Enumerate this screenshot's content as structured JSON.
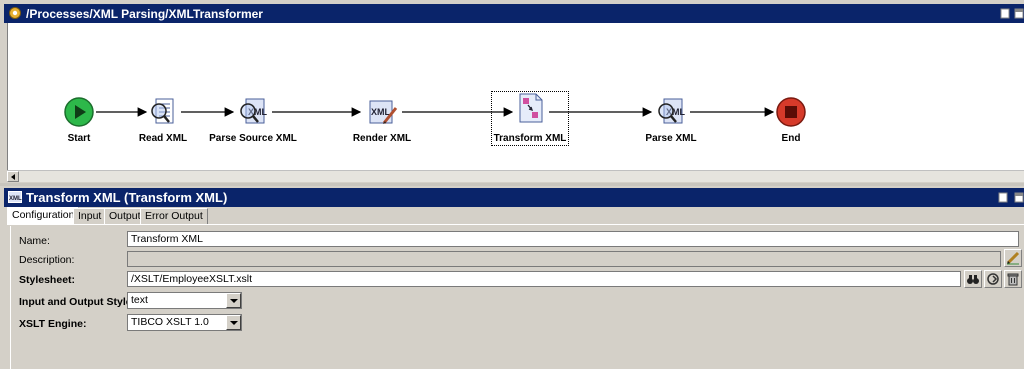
{
  "process": {
    "title": "/Processes/XML Parsing/XMLTransformer",
    "nodes": [
      {
        "label": "Start",
        "icon": "start-icon"
      },
      {
        "label": "Read XML",
        "icon": "read-xml-icon"
      },
      {
        "label": "Parse Source XML",
        "icon": "parse-xml-icon"
      },
      {
        "label": "Render XML",
        "icon": "render-xml-icon"
      },
      {
        "label": "Transform XML",
        "icon": "transform-xml-icon"
      },
      {
        "label": "Parse XML",
        "icon": "parse-xml-icon"
      },
      {
        "label": "End",
        "icon": "end-icon"
      }
    ]
  },
  "props": {
    "title": "Transform XML (Transform XML)",
    "tabs": [
      "Configuration",
      "Input",
      "Output",
      "Error Output"
    ],
    "active_tab": "Configuration",
    "fields": {
      "name_label": "Name:",
      "name_value": "Transform XML",
      "description_label": "Description:",
      "description_value": "",
      "stylesheet_label": "Stylesheet:",
      "stylesheet_value": "/XSLT/EmployeeXSLT.xslt",
      "io_style_label": "Input and Output Style:",
      "io_style_value": "text",
      "engine_label": "XSLT Engine:",
      "engine_value": "TIBCO XSLT 1.0"
    }
  },
  "colors": {
    "titlebar": "#0a246a",
    "start_green": "#2db84a",
    "end_red": "#d63a2a"
  }
}
